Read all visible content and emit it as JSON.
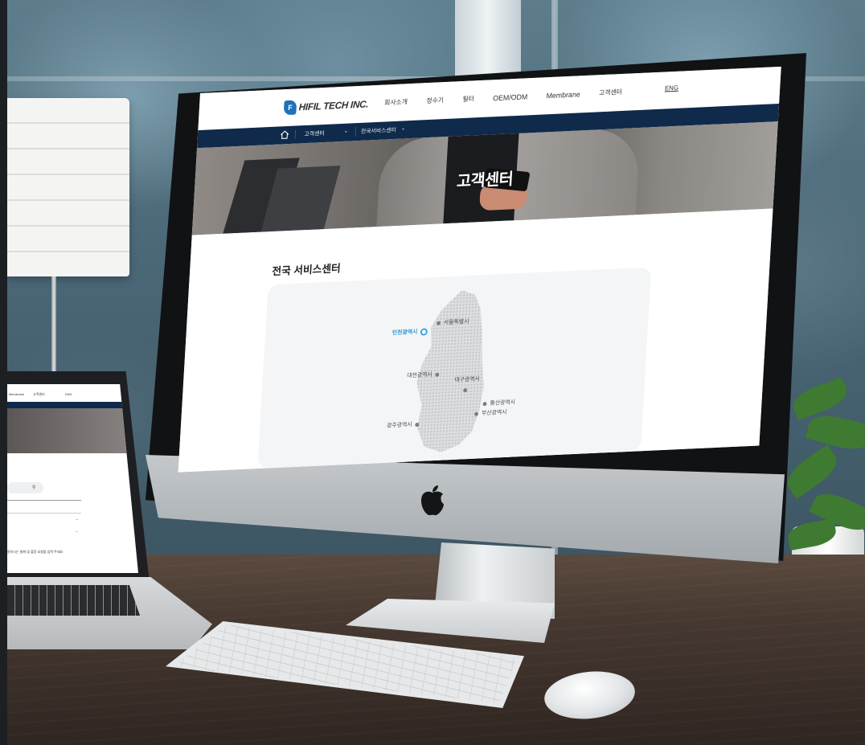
{
  "site": {
    "logo_mark": "F",
    "logo_text": "HIFIL TECH INC.",
    "nav": [
      "회사소개",
      "정수기",
      "필터",
      "OEM/ODM",
      "Membrane",
      "고객센터"
    ],
    "lang": "ENG"
  },
  "breadcrumb": {
    "home_icon": "home-icon",
    "level1": "고객센터",
    "level2": "전국서비스센터"
  },
  "hero": {
    "title": "고객센터"
  },
  "section": {
    "title": "전국 서비스센터"
  },
  "map": {
    "cities": [
      {
        "name": "서울특별시",
        "active": false
      },
      {
        "name": "인천광역시",
        "active": true
      },
      {
        "name": "대전광역시",
        "active": false
      },
      {
        "name": "대구광역시",
        "active": false
      },
      {
        "name": "울산광역시",
        "active": false
      },
      {
        "name": "부산광역시",
        "active": false
      },
      {
        "name": "광주광역시",
        "active": false
      }
    ],
    "active_color": "#39a7e0"
  },
  "laptop": {
    "nav": [
      "Membrane",
      "고객센터",
      "ENG"
    ],
    "search_icon": "search-icon",
    "caption": "원하시는 통화 및 출장 요청을 입력 주세요"
  },
  "colors": {
    "header_navy": "#0f2a4b",
    "logo_blue": "#1d72b8"
  }
}
